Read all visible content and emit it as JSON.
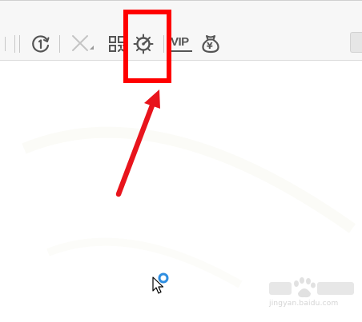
{
  "toolbar": {
    "history_icon": "history-clock-icon",
    "close_icon": "close-x-icon",
    "qr_icon": "qr-code-icon",
    "speed_icon": "speed-gauge-icon",
    "vip_label": "VIP",
    "wallet_icon": "yuan-moneybag-icon",
    "wallet_symbol": "¥"
  },
  "annotation": {
    "box_color": "#ff0000",
    "arrow_color": "#e8141c"
  },
  "watermark": {
    "url": "jingyan.baidu.com"
  },
  "colors": {
    "icon": "#555555",
    "loading_ring": "#2f8ee0"
  }
}
